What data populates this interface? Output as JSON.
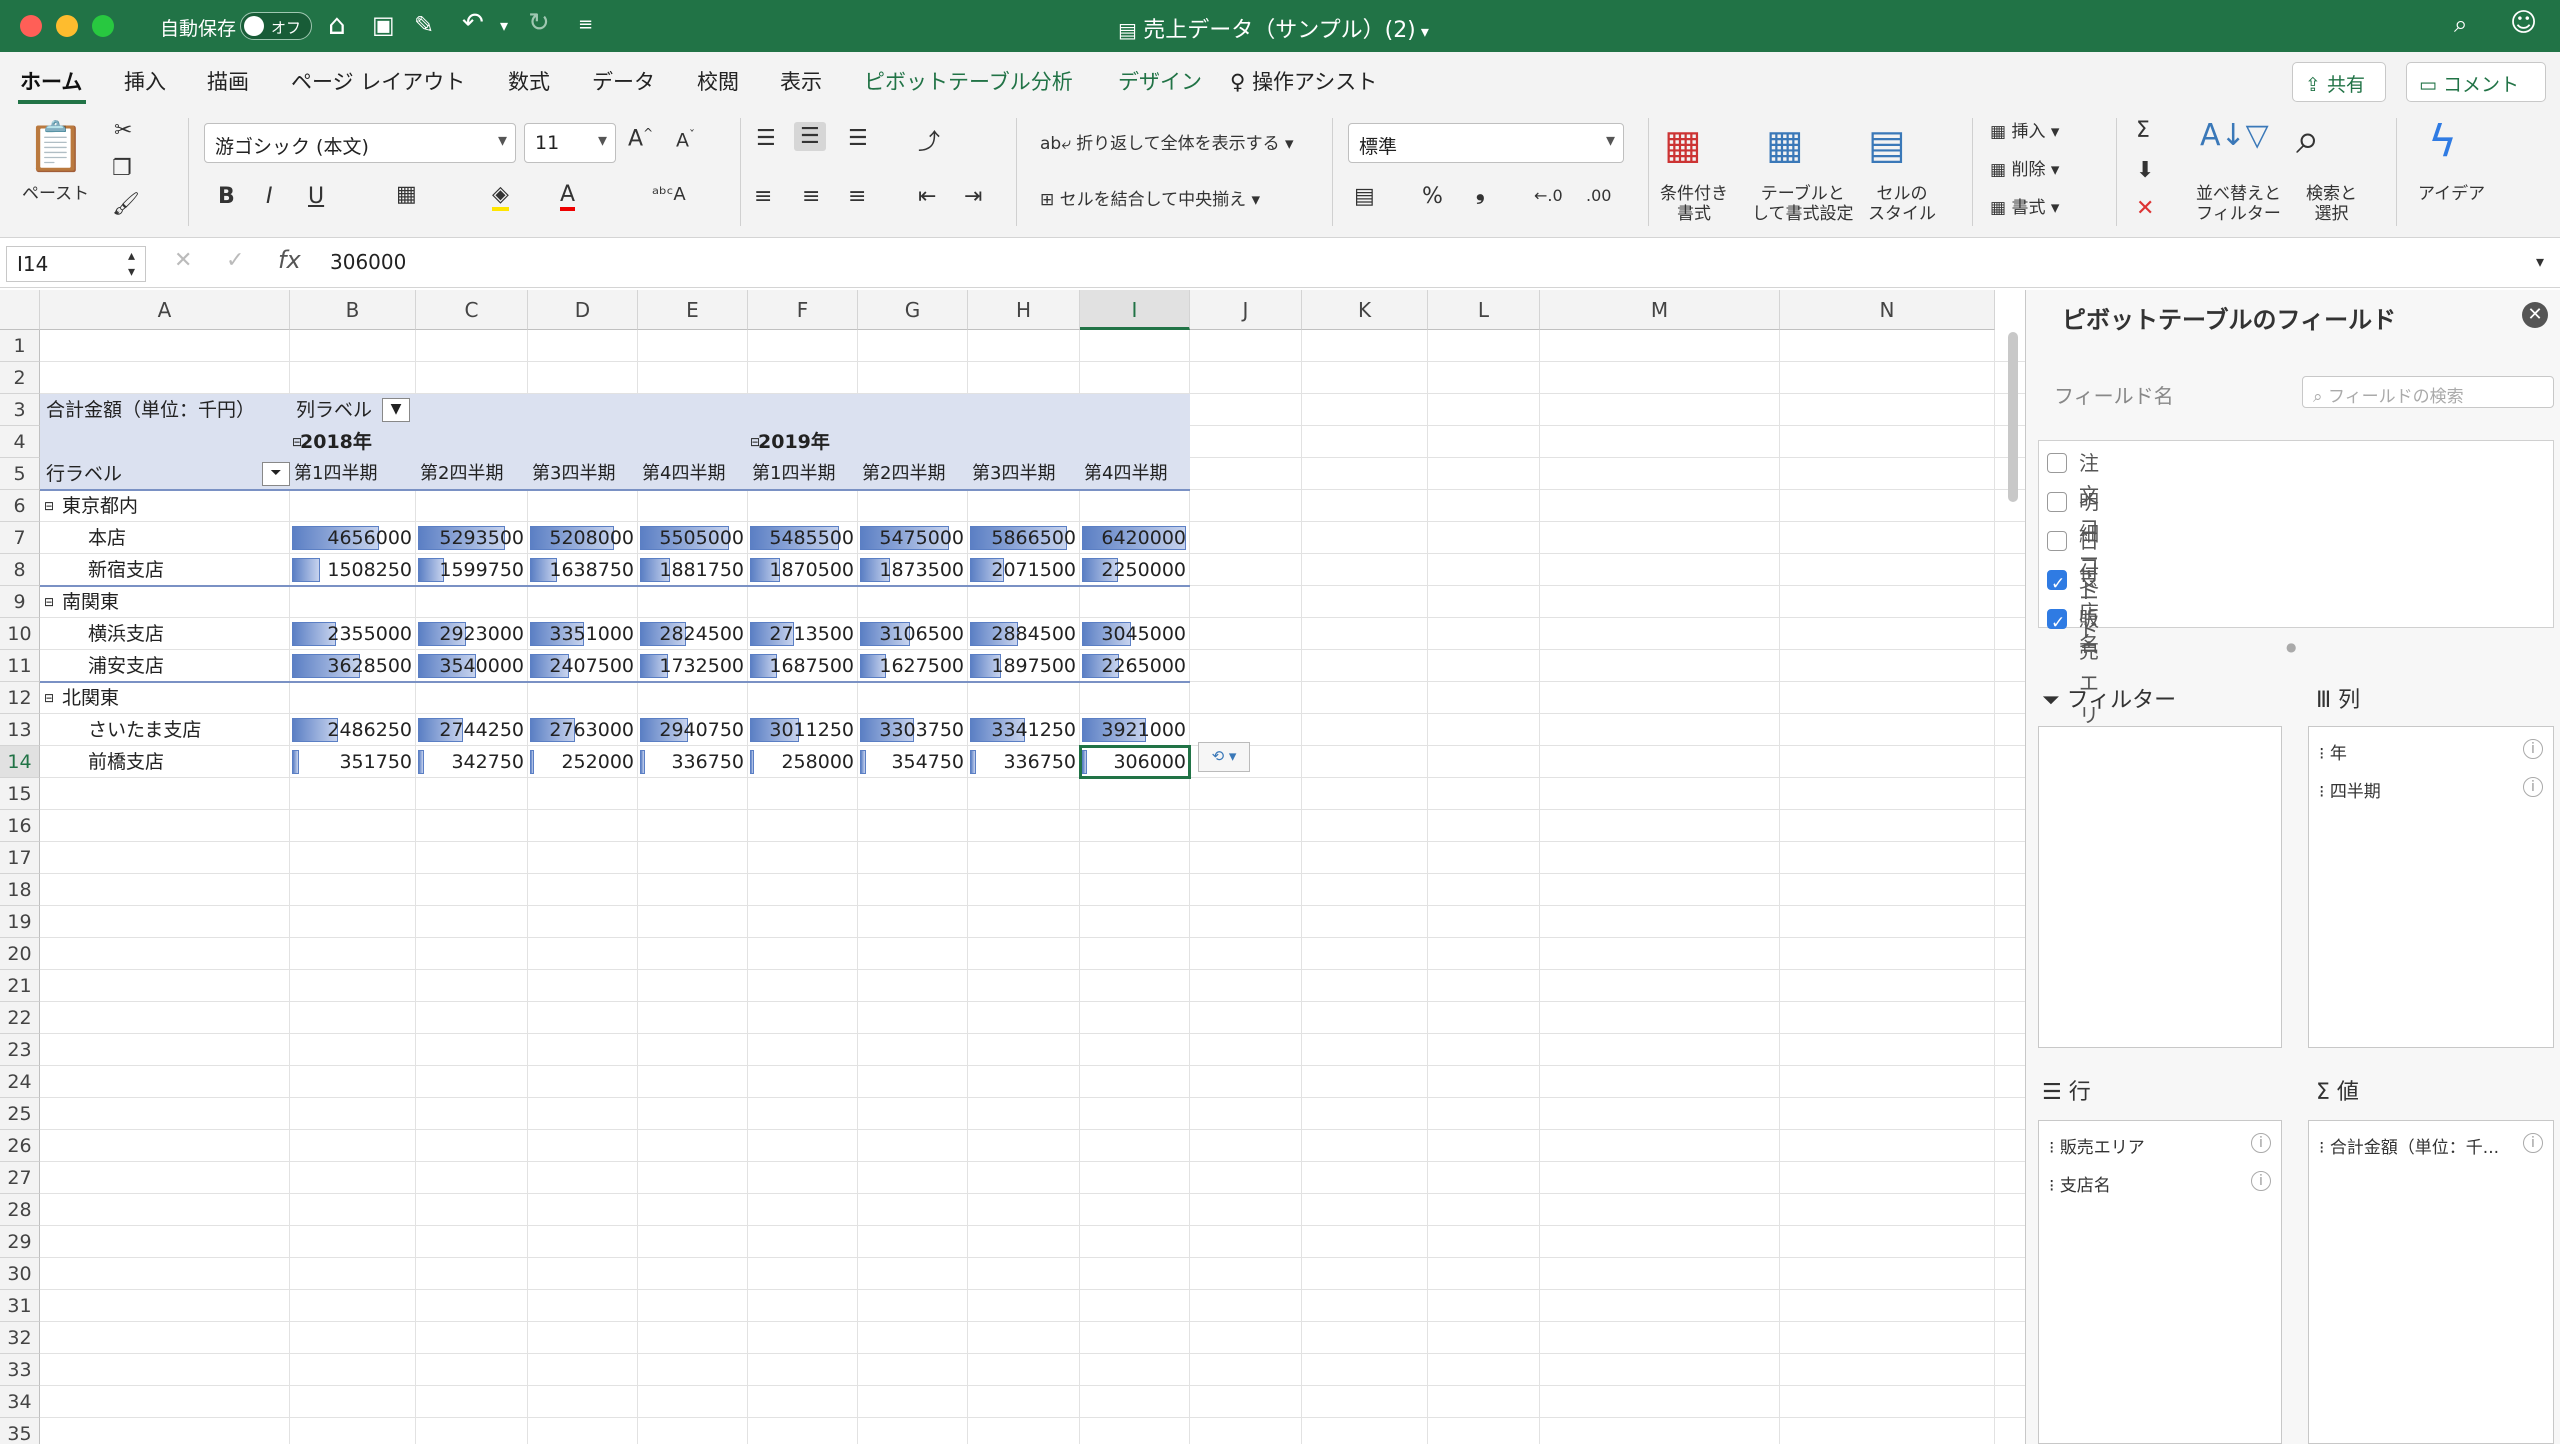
{
  "titlebar": {
    "autosave": "自動保存",
    "toggle": "オフ",
    "doc_title": "売上データ（サンプル）(2)"
  },
  "tabs": [
    "ホーム",
    "挿入",
    "描画",
    "ページ レイアウト",
    "数式",
    "データ",
    "校閲",
    "表示",
    "ピボットテーブル分析",
    "デザイン",
    "操作アシスト"
  ],
  "top_buttons": {
    "share": "共有",
    "comment": "コメント"
  },
  "ribbon": {
    "paste": "ペースト",
    "font_name": "游ゴシック (本文)",
    "font_size": "11",
    "wrap": "折り返して全体を表示する",
    "merge": "セルを結合して中央揃え",
    "number_format": "標準",
    "cond_format": "条件付き\n書式",
    "table_format": "テーブルと\nして書式設定",
    "cell_style": "セルの\nスタイル",
    "insert": "挿入",
    "delete": "削除",
    "format": "書式",
    "sort_filter": "並べ替えと\nフィルター",
    "find": "検索と\n選択",
    "ideas": "アイデア"
  },
  "formula": {
    "name_box": "I14",
    "fx": "fx",
    "value": "306000"
  },
  "columns": [
    "A",
    "B",
    "C",
    "D",
    "E",
    "F",
    "G",
    "H",
    "I",
    "J",
    "K",
    "L",
    "M",
    "N"
  ],
  "rows": [
    "1",
    "2",
    "3",
    "4",
    "5",
    "6",
    "7",
    "8",
    "9",
    "10",
    "11",
    "12",
    "13",
    "14",
    "15",
    "16",
    "17",
    "18",
    "19",
    "20",
    "21",
    "22",
    "23",
    "24",
    "25",
    "26",
    "27",
    "28",
    "29",
    "30",
    "31",
    "32",
    "33",
    "34",
    "35"
  ],
  "pivot": {
    "value_label": "合計金額（単位：千円）",
    "col_label": "列ラベル",
    "row_label": "行ラベル",
    "years": [
      "2018年",
      "2019年"
    ],
    "quarters": [
      "第1四半期",
      "第2四半期",
      "第3四半期",
      "第4四半期",
      "第1四半期",
      "第2四半期",
      "第3四半期",
      "第4四半期"
    ],
    "groups": [
      {
        "name": "東京都内",
        "rows": [
          {
            "name": "本店",
            "values": [
              4656000,
              5293500,
              5208000,
              5505000,
              5485500,
              5475000,
              5866500,
              6420000
            ]
          },
          {
            "name": "新宿支店",
            "values": [
              1508250,
              1599750,
              1638750,
              1881750,
              1870500,
              1873500,
              2071500,
              2250000
            ]
          }
        ]
      },
      {
        "name": "南関東",
        "rows": [
          {
            "name": "横浜支店",
            "values": [
              2355000,
              2923000,
              3351000,
              2824500,
              2713500,
              3106500,
              2884500,
              3045000
            ]
          },
          {
            "name": "浦安支店",
            "values": [
              3628500,
              3540000,
              2407500,
              1732500,
              1687500,
              1627500,
              1897500,
              2265000
            ]
          }
        ]
      },
      {
        "name": "北関東",
        "rows": [
          {
            "name": "さいたま支店",
            "values": [
              2486250,
              2744250,
              2763000,
              2940750,
              3011250,
              3303750,
              3341250,
              3921000
            ]
          },
          {
            "name": "前橋支店",
            "values": [
              351750,
              342750,
              252000,
              336750,
              258000,
              354750,
              336750,
              306000
            ]
          }
        ]
      }
    ]
  },
  "panel": {
    "title": "ピボットテーブルのフィールド",
    "field_name": "フィールド名",
    "search_placeholder": "フィールドの検索",
    "fields": [
      {
        "name": "注文コード",
        "checked": false
      },
      {
        "name": "明細コード",
        "checked": false
      },
      {
        "name": "日付",
        "checked": false
      },
      {
        "name": "支店名",
        "checked": true
      },
      {
        "name": "販売エリア",
        "checked": true
      }
    ],
    "filter": "フィルター",
    "columns": "列",
    "rows": "行",
    "values": "値",
    "col_items": [
      "年",
      "四半期"
    ],
    "row_items": [
      "販売エリア",
      "支店名"
    ],
    "value_items": [
      "合計金額（単位：千..."
    ]
  }
}
